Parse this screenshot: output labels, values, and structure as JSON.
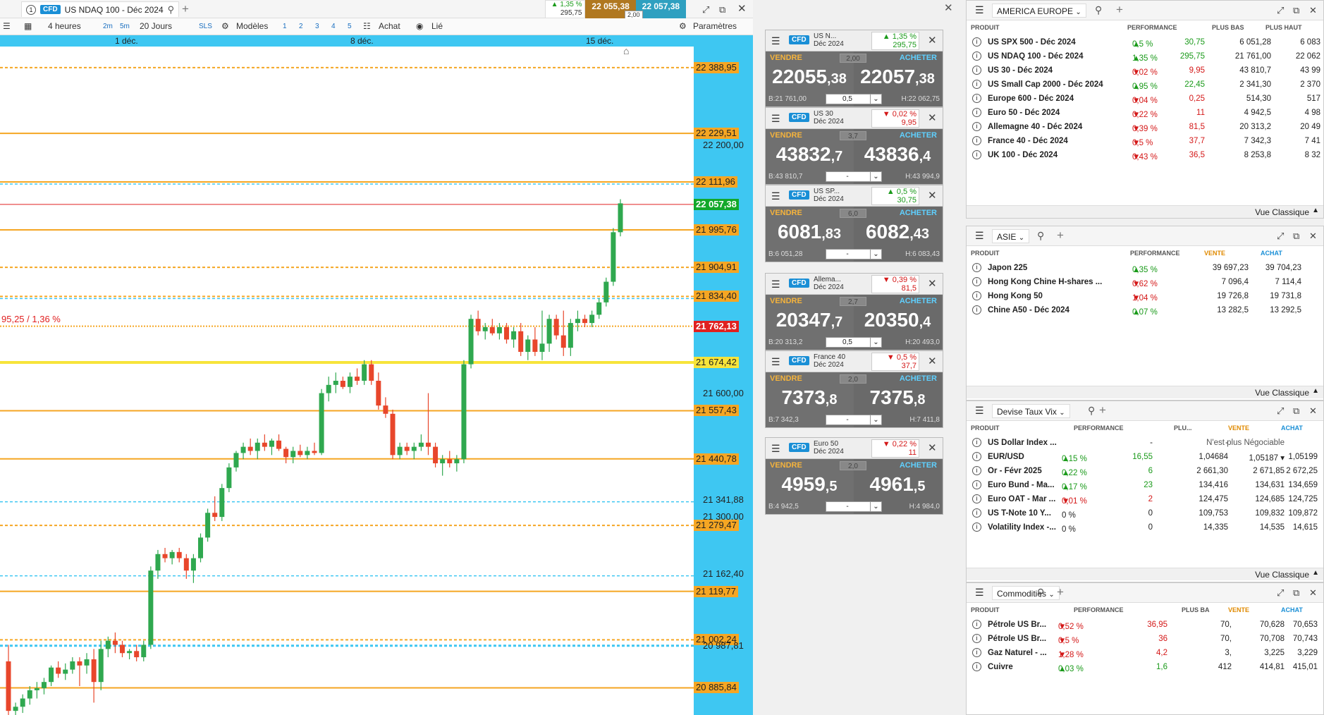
{
  "chart_tab": {
    "number": "1",
    "badge": "CFD",
    "title": "US NDAQ 100 - Déc 2024"
  },
  "header_quote": {
    "perf_pct": "1,35 %",
    "perf_abs": "295,75",
    "sell": "22 055,38",
    "buy": "22 057,38",
    "spread": "2,00"
  },
  "toolbar": {
    "interval": "4 heures",
    "btn_2m": "2m",
    "btn_5m": "5m",
    "period": "20 Jours",
    "sls": "SLS",
    "models": "Modèles",
    "n1": "1",
    "n2": "2",
    "n3": "3",
    "n4": "4",
    "n5": "5",
    "buy": "Achat",
    "linked": "Lié",
    "settings": "Paramètres"
  },
  "x_axis": [
    "1 déc.",
    "8 déc.",
    "15 déc."
  ],
  "y_levels": [
    {
      "label": "22 388,95",
      "style": "or"
    },
    {
      "label": "22 229,51",
      "style": "or"
    },
    {
      "label": "22 200,00",
      "style": "pl"
    },
    {
      "label": "22 111,96",
      "style": "or"
    },
    {
      "label": "22 057,38",
      "style": "gr"
    },
    {
      "label": "21 995,76",
      "style": "or"
    },
    {
      "label": "21 904,91",
      "style": "or"
    },
    {
      "label": "21 834,40",
      "style": "or"
    },
    {
      "label": "21 762,13",
      "style": "rd"
    },
    {
      "label": "21 674,42",
      "style": "ye"
    },
    {
      "label": "21 600,00",
      "style": "pl"
    },
    {
      "label": "21 557,43",
      "style": "or"
    },
    {
      "label": "21 440,78",
      "style": "or"
    },
    {
      "label": "21 341,88",
      "style": "pl"
    },
    {
      "label": "21 300,00",
      "style": "pl"
    },
    {
      "label": "21 279,47",
      "style": "or"
    },
    {
      "label": "21 162,40",
      "style": "pl"
    },
    {
      "label": "21 119,77",
      "style": "or"
    },
    {
      "label": "21 002,24",
      "style": "or"
    },
    {
      "label": "20 987,81",
      "style": "pl"
    },
    {
      "label": "20 885,84",
      "style": "or"
    }
  ],
  "chart_annotation": "95,25 / 1,36 %",
  "chart_data": {
    "type": "candlestick",
    "title": "US NDAQ 100 - Déc 2024",
    "x_ticks": [
      "1 déc.",
      "8 déc.",
      "15 déc."
    ],
    "ylim": [
      20820,
      22440
    ],
    "ohlc": [
      [
        20950,
        20990,
        20820,
        20830
      ],
      [
        20830,
        20850,
        20820,
        20840
      ],
      [
        20840,
        20870,
        20825,
        20860
      ],
      [
        20860,
        20890,
        20845,
        20880
      ],
      [
        20880,
        20900,
        20860,
        20885
      ],
      [
        20885,
        20910,
        20870,
        20900
      ],
      [
        20900,
        20940,
        20890,
        20935
      ],
      [
        20935,
        20950,
        20910,
        20920
      ],
      [
        20920,
        20945,
        20905,
        20930
      ],
      [
        20930,
        20960,
        20920,
        20950
      ],
      [
        20950,
        20960,
        20890,
        20940
      ],
      [
        20940,
        20970,
        20920,
        20955
      ],
      [
        20955,
        20980,
        20850,
        20900
      ],
      [
        20900,
        21000,
        20880,
        20980
      ],
      [
        20980,
        21010,
        20960,
        21000
      ],
      [
        21000,
        21020,
        20970,
        20990
      ],
      [
        20990,
        21000,
        20960,
        20970
      ],
      [
        20970,
        20980,
        20955,
        20975
      ],
      [
        20975,
        20990,
        20950,
        20960
      ],
      [
        20960,
        21000,
        20950,
        20990
      ],
      [
        20990,
        21180,
        20980,
        21170
      ],
      [
        21170,
        21220,
        21150,
        21210
      ],
      [
        21210,
        21225,
        21190,
        21200
      ],
      [
        21200,
        21220,
        21185,
        21215
      ],
      [
        21215,
        21225,
        21190,
        21200
      ],
      [
        21200,
        21210,
        21150,
        21170
      ],
      [
        21170,
        21210,
        21140,
        21200
      ],
      [
        21200,
        21260,
        21190,
        21250
      ],
      [
        21250,
        21320,
        21240,
        21310
      ],
      [
        21310,
        21350,
        21290,
        21300
      ],
      [
        21300,
        21380,
        21290,
        21370
      ],
      [
        21370,
        21430,
        21360,
        21420
      ],
      [
        21420,
        21460,
        21410,
        21455
      ],
      [
        21455,
        21480,
        21440,
        21470
      ],
      [
        21470,
        21490,
        21450,
        21460
      ],
      [
        21460,
        21490,
        21440,
        21480
      ],
      [
        21480,
        21500,
        21460,
        21470
      ],
      [
        21470,
        21490,
        21450,
        21485
      ],
      [
        21485,
        21500,
        21460,
        21465
      ],
      [
        21465,
        21470,
        21430,
        21445
      ],
      [
        21445,
        21470,
        21430,
        21460
      ],
      [
        21460,
        21475,
        21445,
        21450
      ],
      [
        21450,
        21470,
        21440,
        21460
      ],
      [
        21460,
        21480,
        21450,
        21455
      ],
      [
        21455,
        21610,
        21450,
        21600
      ],
      [
        21600,
        21640,
        21580,
        21620
      ],
      [
        21620,
        21650,
        21600,
        21630
      ],
      [
        21630,
        21640,
        21610,
        21615
      ],
      [
        21615,
        21650,
        21600,
        21640
      ],
      [
        21640,
        21660,
        21620,
        21630
      ],
      [
        21630,
        21680,
        21620,
        21670
      ],
      [
        21670,
        21680,
        21620,
        21630
      ],
      [
        21630,
        21650,
        21560,
        21570
      ],
      [
        21570,
        21590,
        21540,
        21550
      ],
      [
        21550,
        21560,
        21440,
        21450
      ],
      [
        21450,
        21480,
        21440,
        21470
      ],
      [
        21470,
        21480,
        21450,
        21460
      ],
      [
        21460,
        21480,
        21440,
        21470
      ],
      [
        21470,
        21500,
        21460,
        21480
      ],
      [
        21480,
        21600,
        21450,
        21470
      ],
      [
        21470,
        21480,
        21420,
        21430
      ],
      [
        21430,
        21450,
        21400,
        21440
      ],
      [
        21440,
        21460,
        21420,
        21430
      ],
      [
        21430,
        21450,
        21410,
        21440
      ],
      [
        21440,
        21680,
        21430,
        21670
      ],
      [
        21670,
        21790,
        21660,
        21780
      ],
      [
        21780,
        21800,
        21740,
        21750
      ],
      [
        21750,
        21770,
        21730,
        21760
      ],
      [
        21760,
        21780,
        21740,
        21745
      ],
      [
        21745,
        21770,
        21730,
        21760
      ],
      [
        21760,
        21770,
        21720,
        21730
      ],
      [
        21730,
        21760,
        21710,
        21750
      ],
      [
        21750,
        21770,
        21690,
        21700
      ],
      [
        21700,
        21740,
        21680,
        21730
      ],
      [
        21730,
        21760,
        21690,
        21700
      ],
      [
        21700,
        21800,
        21680,
        21720
      ],
      [
        21720,
        21790,
        21700,
        21780
      ],
      [
        21780,
        21790,
        21730,
        21740
      ],
      [
        21740,
        21800,
        21690,
        21710
      ],
      [
        21710,
        21780,
        21690,
        21770
      ],
      [
        21770,
        21800,
        21750,
        21780
      ],
      [
        21780,
        21790,
        21760,
        21770
      ],
      [
        21770,
        21800,
        21760,
        21790
      ],
      [
        21790,
        21830,
        21780,
        21820
      ],
      [
        21820,
        21880,
        21810,
        21870
      ],
      [
        21870,
        22000,
        21860,
        21990
      ],
      [
        21990,
        22070,
        21980,
        22060
      ]
    ]
  },
  "widgets": [
    {
      "name1": "US N...",
      "name2": "Déc 2024",
      "perf": "1,35 %",
      "abs": "295,75",
      "dir": "up",
      "sell_main": "22055",
      "sell_dec": ",38",
      "buy_main": "22057",
      "buy_dec": ",38",
      "spread": "2,00",
      "low": "B:21 761,00",
      "high": "H:22 062,75",
      "qty": "0,5"
    },
    {
      "name1": "US 30",
      "name2": "Déc 2024",
      "perf": "0,02 %",
      "abs": "9,95",
      "dir": "dn",
      "sell_main": "43832",
      "sell_dec": ",7",
      "buy_main": "43836",
      "buy_dec": ",4",
      "spread": "3,7",
      "low": "B:43 810,7",
      "high": "H:43 994,9",
      "qty": "-"
    },
    {
      "name1": "US SP...",
      "name2": "Déc 2024",
      "perf": "0,5 %",
      "abs": "30,75",
      "dir": "up",
      "sell_main": "6081",
      "sell_dec": ",83",
      "buy_main": "6082",
      "buy_dec": ",43",
      "spread": "6,0",
      "low": "B:6 051,28",
      "high": "H:6 083,43",
      "qty": "-"
    },
    {
      "name1": "Allema...",
      "name2": "Déc 2024",
      "perf": "0,39 %",
      "abs": "81,5",
      "dir": "dn",
      "sell_main": "20347",
      "sell_dec": ",7",
      "buy_main": "20350",
      "buy_dec": ",4",
      "spread": "2,7",
      "low": "B:20 313,2",
      "high": "H:20 493,0",
      "qty": "0,5"
    },
    {
      "name1": "France 40",
      "name2": "Déc 2024",
      "perf": "0,5 %",
      "abs": "37,7",
      "dir": "dn",
      "sell_main": "7373",
      "sell_dec": ",8",
      "buy_main": "7375",
      "buy_dec": ",8",
      "spread": "2,0",
      "low": "B:7 342,3",
      "high": "H:7 411,8",
      "qty": "-"
    },
    {
      "name1": "Euro 50",
      "name2": "Déc 2024",
      "perf": "0,22 %",
      "abs": "11",
      "dir": "dn",
      "sell_main": "4959",
      "sell_dec": ",5",
      "buy_main": "4961",
      "buy_dec": ",5",
      "spread": "2,0",
      "low": "B:4 942,5",
      "high": "H:4 984,0",
      "qty": "-"
    }
  ],
  "widget_labels": {
    "sell": "VENDRE",
    "buy": "ACHETER",
    "badge": "CFD"
  },
  "panels": [
    {
      "title": "AMERICA EUROPE",
      "cols": [
        "PRODUIT",
        "PERFORMANCE",
        "PLUS BAS",
        "PLUS HAUT"
      ],
      "rows": [
        {
          "name": "US SPX 500 - Déc 2024",
          "pct": "0,5 %",
          "abs": "30,75",
          "dir": "up",
          "c3": "6 051,28",
          "c4": "6 083"
        },
        {
          "name": "US NDAQ 100 - Déc 2024",
          "pct": "1,35 %",
          "abs": "295,75",
          "dir": "up",
          "c3": "21 761,00",
          "c4": "22 062"
        },
        {
          "name": "US 30 - Déc 2024",
          "pct": "0,02 %",
          "abs": "9,95",
          "dir": "dn",
          "c3": "43 810,7",
          "c4": "43 99"
        },
        {
          "name": "US Small Cap 2000 - Déc 2024",
          "pct": "0,95 %",
          "abs": "22,45",
          "dir": "up",
          "c3": "2 341,30",
          "c4": "2 370"
        },
        {
          "name": "Europe 600 - Déc 2024",
          "pct": "0,04 %",
          "abs": "0,25",
          "dir": "dn",
          "c3": "514,30",
          "c4": "517"
        },
        {
          "name": "Euro 50 - Déc 2024",
          "pct": "0,22 %",
          "abs": "11",
          "dir": "dn",
          "c3": "4 942,5",
          "c4": "4 98"
        },
        {
          "name": "Allemagne 40 - Déc 2024",
          "pct": "0,39 %",
          "abs": "81,5",
          "dir": "dn",
          "c3": "20 313,2",
          "c4": "20 49"
        },
        {
          "name": "France 40 - Déc 2024",
          "pct": "0,5 %",
          "abs": "37,7",
          "dir": "dn",
          "c3": "7 342,3",
          "c4": "7 41"
        },
        {
          "name": "UK 100 - Déc 2024",
          "pct": "0,43 %",
          "abs": "36,5",
          "dir": "dn",
          "c3": "8 253,8",
          "c4": "8 32"
        }
      ],
      "footer": "Vue Classique"
    },
    {
      "title": "ASIE",
      "cols": [
        "PRODUIT",
        "PERFORMANCE",
        "VENTE",
        "ACHAT"
      ],
      "rows": [
        {
          "name": "Japon 225",
          "pct": "0,35 %",
          "abs": "",
          "dir": "up",
          "c3": "39 697,23",
          "c4": "39 704,23"
        },
        {
          "name": "Hong Kong Chine H-shares ...",
          "pct": "0,62 %",
          "abs": "",
          "dir": "dn",
          "c3": "7 096,4",
          "c4": "7 114,4"
        },
        {
          "name": "Hong Kong 50",
          "pct": "1,04 %",
          "abs": "",
          "dir": "dn",
          "c3": "19 726,8",
          "c4": "19 731,8"
        },
        {
          "name": "Chine A50 - Déc 2024",
          "pct": "0,07 %",
          "abs": "",
          "dir": "up",
          "c3": "13 282,5",
          "c4": "13 292,5"
        }
      ],
      "footer": "Vue Classique"
    },
    {
      "title": "Devise Taux Vix",
      "cols": [
        "PRODUIT",
        "PERFORMANCE",
        "PLU...",
        "VENTE",
        "ACHAT"
      ],
      "rows": [
        {
          "name": "US Dollar Index ...",
          "pct": "",
          "abs": "-",
          "dir": "",
          "c3": "-",
          "c4": "N'est plus Négociable",
          "c5": ""
        },
        {
          "name": "EUR/USD",
          "pct": "0,15 %",
          "abs": "16,55",
          "dir": "up",
          "c3": "1,04684",
          "c4": "1,05187 ▾",
          "c5": "1,05199"
        },
        {
          "name": "Or - Févr 2025",
          "pct": "0,22 %",
          "abs": "6",
          "dir": "up",
          "c3": "2 661,30",
          "c4": "2 671,85",
          "c5": "2 672,25"
        },
        {
          "name": "Euro Bund - Ma...",
          "pct": "0,17 %",
          "abs": "23",
          "dir": "up",
          "c3": "134,416",
          "c4": "134,631",
          "c5": "134,659"
        },
        {
          "name": "Euro OAT - Mar ...",
          "pct": "0,01 %",
          "abs": "2",
          "dir": "dn",
          "c3": "124,475",
          "c4": "124,685",
          "c5": "124,725"
        },
        {
          "name": "US T-Note 10 Y...",
          "pct": "0 %",
          "abs": "0",
          "dir": "",
          "c3": "109,753",
          "c4": "109,832",
          "c5": "109,872"
        },
        {
          "name": "Volatility Index -...",
          "pct": "0 %",
          "abs": "0",
          "dir": "",
          "c3": "14,335",
          "c4": "14,535",
          "c5": "14,615"
        }
      ],
      "footer": "Vue Classique"
    },
    {
      "title": "Commodities",
      "cols": [
        "PRODUIT",
        "PERFORMANCE",
        "PLUS BA",
        "VENTE",
        "ACHAT"
      ],
      "rows": [
        {
          "name": "Pétrole US Br...",
          "pct": "0,52 %",
          "abs": "36,95",
          "dir": "dn",
          "c3": "70,",
          "c4": "70,628",
          "c5": "70,653"
        },
        {
          "name": "Pétrole US Br...",
          "pct": "0,5 %",
          "abs": "36",
          "dir": "dn",
          "c3": "70,",
          "c4": "70,708",
          "c5": "70,743"
        },
        {
          "name": "Gaz Naturel - ...",
          "pct": "1,28 %",
          "abs": "4,2",
          "dir": "dn",
          "c3": "3,",
          "c4": "3,225",
          "c5": "3,229"
        },
        {
          "name": "Cuivre",
          "pct": "0,03 %",
          "abs": "1,6",
          "dir": "up",
          "c3": "412",
          "c4": "414,81",
          "c5": "415,01"
        }
      ],
      "footer": ""
    }
  ],
  "colors": {
    "axis_bg": "#3ec7f2",
    "level_orange": "#f5a623",
    "up_candle": "#2fa84f",
    "down_candle": "#e8462b",
    "support_yellow": "#f7e43a",
    "price_red": "#e02020"
  }
}
